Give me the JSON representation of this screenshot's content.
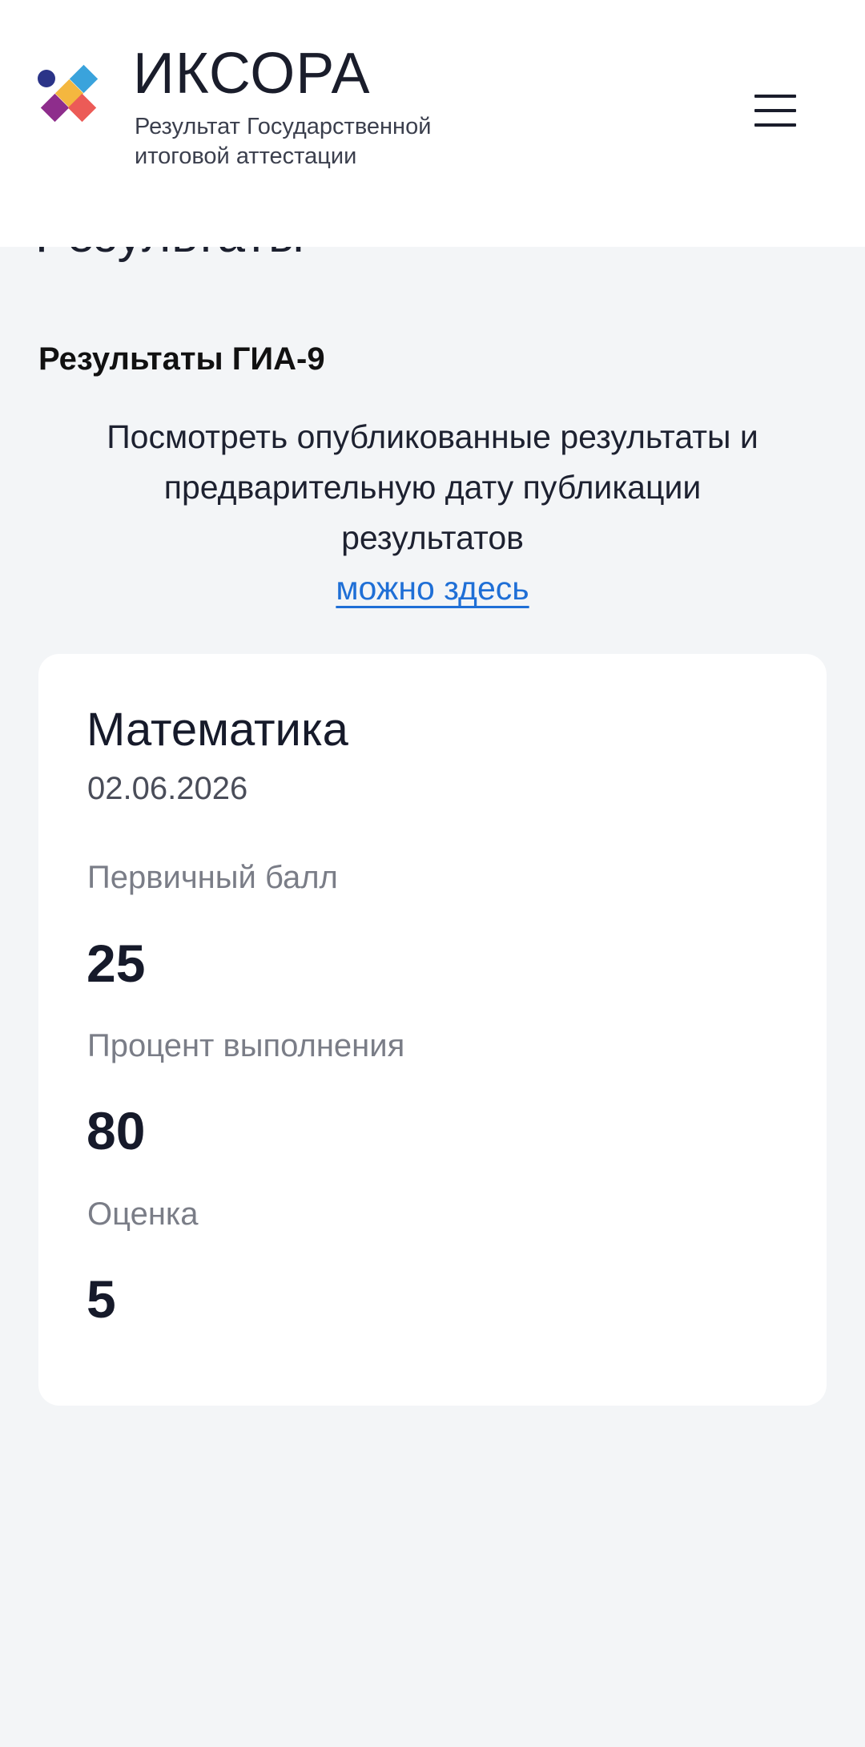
{
  "header": {
    "brand_name": "ИКСОРА",
    "subtitle_line1": "Результат Государственной",
    "subtitle_line2": "итоговой аттестации",
    "logo_icon": "iksora-logo-mark",
    "menu_icon": "hamburger-menu-icon"
  },
  "page": {
    "heading": "Результаты",
    "section_title": "Результаты ГИА-9",
    "info_line1": "Посмотреть опубликованные результаты и",
    "info_line2": "предварительную дату публикации",
    "info_line3": "результатов",
    "link_text": "можно здесь"
  },
  "result": {
    "subject": "Математика",
    "date": "02.06.2026",
    "primary_score_label": "Первичный балл",
    "primary_score": "25",
    "percent_label": "Процент выполнения",
    "percent": "80",
    "grade_label": "Оценка",
    "grade": "5"
  },
  "colors": {
    "background": "#f3f5f7",
    "link": "#1f6fd6",
    "text": "#161a2a",
    "logo_navy": "#2b3488",
    "logo_blue": "#3aa3dc",
    "logo_yellow": "#f4b73f",
    "logo_purple": "#8e2d8c",
    "logo_red": "#ec5b57"
  }
}
